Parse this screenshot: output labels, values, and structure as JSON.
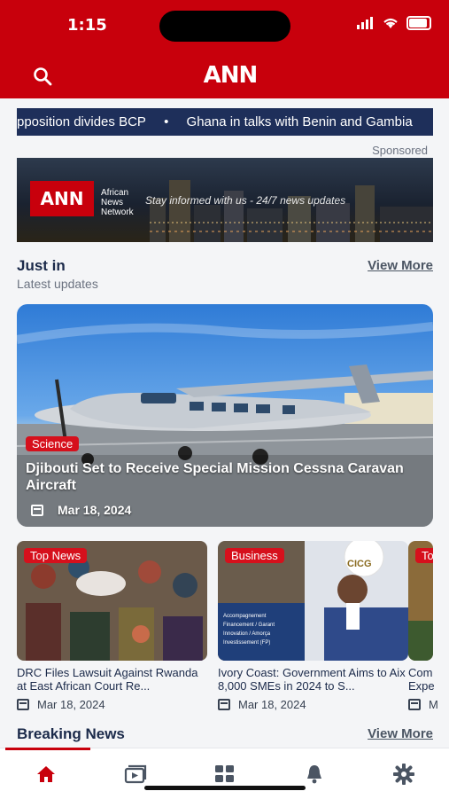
{
  "status_bar": {
    "time": "1:15"
  },
  "header": {
    "logo_text": "ANN",
    "search_icon": "search-icon",
    "background": "#c8000c"
  },
  "ticker": {
    "items": [
      "pposition divides BCP",
      "•",
      "Ghana in talks with Benin and Gambia"
    ]
  },
  "ad": {
    "sponsored_label": "Sponsored",
    "logo_text": "ANN",
    "network_lines": [
      "African",
      "News",
      "Network"
    ],
    "tagline": "Stay informed with us - 24/7 news updates"
  },
  "just_in": {
    "title": "Just in",
    "subtitle": "Latest updates",
    "view_more": "View More"
  },
  "hero": {
    "category": "Science",
    "headline": "Djibouti Set to Receive Special Mission Cessna Caravan Aircraft",
    "date": "Mar 18, 2024"
  },
  "cards": [
    {
      "category": "Top News",
      "title": "DRC Files Lawsuit Against Rwanda at East African Court Re...",
      "date": "Mar 18, 2024"
    },
    {
      "category": "Business",
      "title": "Ivory Coast: Government Aims to Aix 8,000 SMEs in 2024 to S...",
      "date": "Mar 18, 2024"
    },
    {
      "category": "To",
      "title": "Com Expe",
      "date": "M"
    }
  ],
  "card_image_text": {
    "cicg": "CICG",
    "lines": [
      "Accompagnement",
      "Financement / Garant",
      "Innovation / Amorça",
      "Investissement (FP)"
    ]
  },
  "breaking": {
    "title": "Breaking News",
    "view_more": "View More"
  },
  "bottom_nav": [
    "home-icon",
    "video-icon",
    "grid-icon",
    "bell-icon",
    "gear-icon"
  ],
  "colors": {
    "accent": "#c8000c",
    "navy": "#1b2a4a",
    "ticker_bg": "#1e2f5a"
  }
}
